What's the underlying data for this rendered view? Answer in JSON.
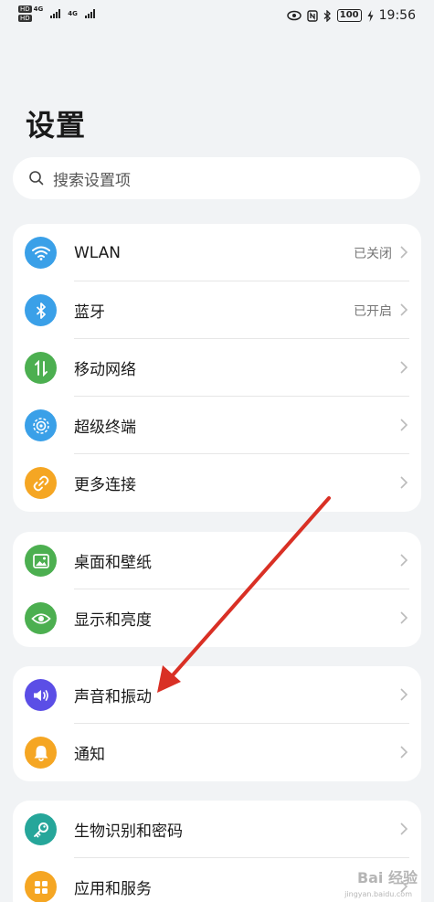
{
  "status_bar": {
    "sim1_hd": "HD",
    "sim1_net": "4G",
    "sim2_hd": "HD",
    "sim2_net": "4G",
    "battery": "100",
    "time": "19:56"
  },
  "title": "设置",
  "search": {
    "placeholder": "搜索设置项"
  },
  "groups": [
    {
      "items": [
        {
          "label": "WLAN",
          "value": "已关闭",
          "icon": "wifi-icon",
          "color": "#3aa0e8"
        },
        {
          "label": "蓝牙",
          "value": "已开启",
          "icon": "bluetooth-icon",
          "color": "#3aa0e8"
        },
        {
          "label": "移动网络",
          "value": "",
          "icon": "mobile-data-icon",
          "color": "#4caf50"
        },
        {
          "label": "超级终端",
          "value": "",
          "icon": "super-device-icon",
          "color": "#3aa0e8"
        },
        {
          "label": "更多连接",
          "value": "",
          "icon": "link-icon",
          "color": "#f5a623"
        }
      ]
    },
    {
      "items": [
        {
          "label": "桌面和壁纸",
          "value": "",
          "icon": "wallpaper-icon",
          "color": "#4caf50"
        },
        {
          "label": "显示和亮度",
          "value": "",
          "icon": "eye-icon",
          "color": "#4caf50"
        }
      ]
    },
    {
      "items": [
        {
          "label": "声音和振动",
          "value": "",
          "icon": "volume-icon",
          "color": "#5b4ee6"
        },
        {
          "label": "通知",
          "value": "",
          "icon": "bell-icon",
          "color": "#f5a623"
        }
      ]
    },
    {
      "items": [
        {
          "label": "生物识别和密码",
          "value": "",
          "icon": "key-icon",
          "color": "#26a69a"
        },
        {
          "label": "应用和服务",
          "value": "",
          "icon": "apps-icon",
          "color": "#f5a623"
        }
      ]
    }
  ],
  "annotation": {
    "arrow_color": "#d93025"
  },
  "watermark": {
    "text": "Bai 经验",
    "sub": "jingyan.baidu.com"
  }
}
